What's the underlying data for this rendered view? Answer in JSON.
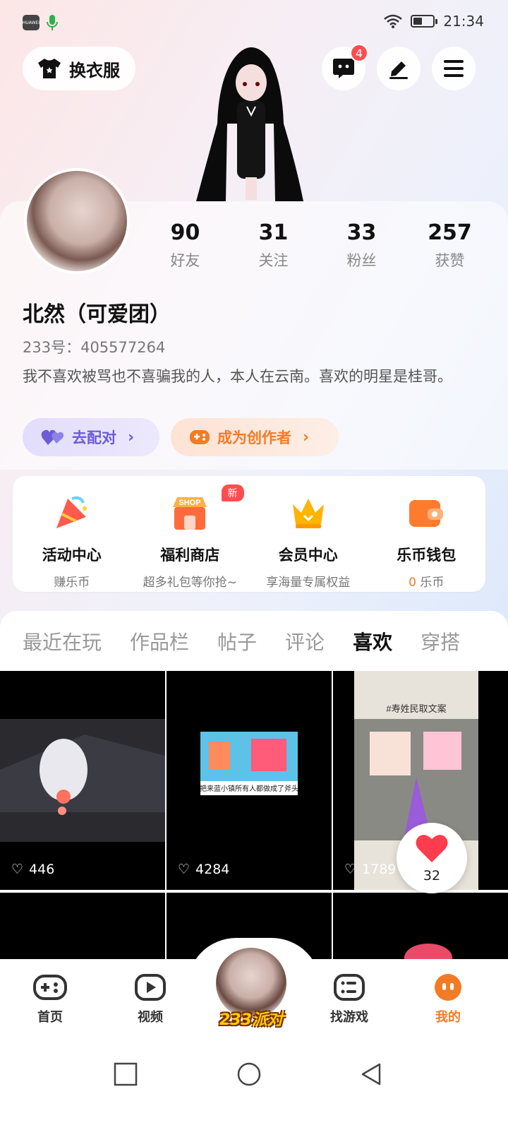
{
  "status_bar": {
    "time": "21:34",
    "app_label": "HUAWEI"
  },
  "header": {
    "outfit_label": "换衣服",
    "messages_badge": "4"
  },
  "profile": {
    "stats": [
      {
        "num": "90",
        "label": "好友"
      },
      {
        "num": "31",
        "label": "关注"
      },
      {
        "num": "33",
        "label": "粉丝"
      },
      {
        "num": "257",
        "label": "获赞"
      }
    ],
    "nickname": "北然（可爱团）",
    "uid": "233号：405577264",
    "bio": "我不喜欢被骂也不喜骗我的人，本人在云南。喜欢的明星是桂哥。",
    "match_label": "去配对",
    "creator_label": "成为创作者"
  },
  "features": [
    {
      "title": "活动中心",
      "sub": "赚乐币",
      "icon": "party-popper-icon"
    },
    {
      "title": "福利商店",
      "sub": "超多礼包等你抢~",
      "icon": "shop-icon",
      "badge": "新",
      "shop_sign": "SHOP"
    },
    {
      "title": "会员中心",
      "sub": "享海量专属权益",
      "icon": "crown-icon"
    },
    {
      "title": "乐币钱包",
      "sub_num": "0",
      "sub_unit": "乐币",
      "icon": "wallet-icon"
    }
  ],
  "tabs": [
    "最近在玩",
    "作品栏",
    "帖子",
    "评论",
    "喜欢",
    "穿搭"
  ],
  "active_tab": "喜欢",
  "grid": [
    {
      "likes": "446"
    },
    {
      "likes": "4284",
      "caption": "把来蓝小镇所有人都做成了斧头"
    },
    {
      "likes": "1789",
      "caption": "#寿姓民取文案"
    }
  ],
  "like_float": {
    "count": "32"
  },
  "bottom_nav": [
    {
      "label": "首页",
      "icon": "gamepad-icon"
    },
    {
      "label": "视频",
      "icon": "video-play-icon"
    },
    {
      "label": "233派对",
      "icon": "party-avatar"
    },
    {
      "label": "找游戏",
      "icon": "game-list-icon"
    },
    {
      "label": "我的",
      "icon": "me-face-icon"
    }
  ],
  "colors": {
    "accent": "#f47b26",
    "match": "#6c5cd6",
    "badge": "#ff4d4f"
  }
}
